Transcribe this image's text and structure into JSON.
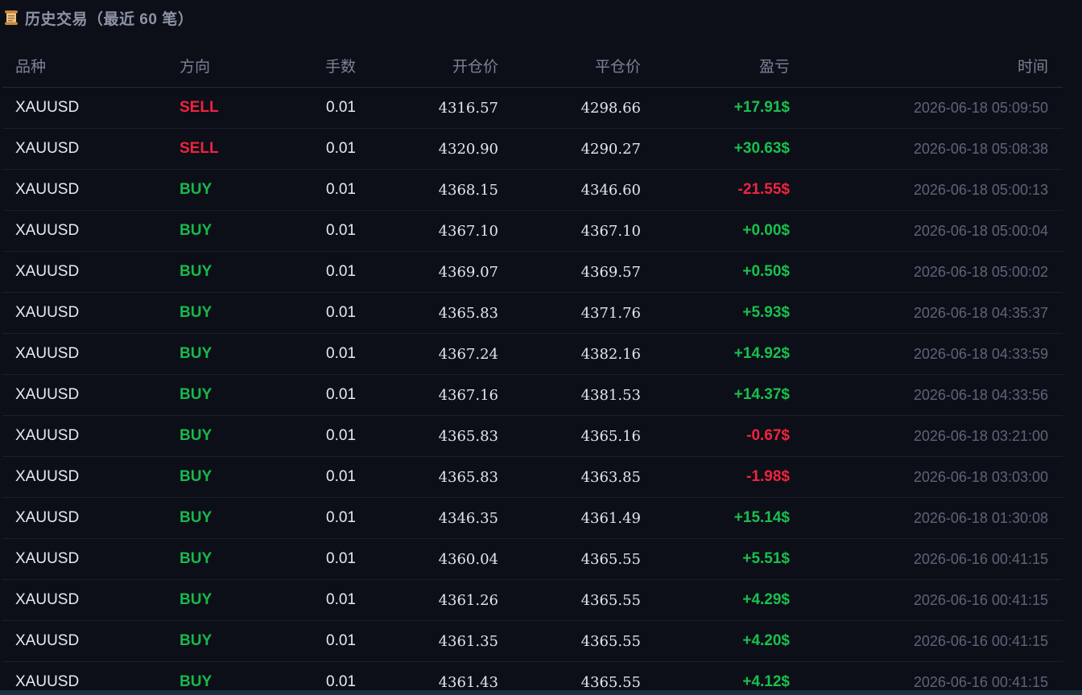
{
  "panel": {
    "icon": "scroll-icon",
    "title": "历史交易（最近 60 笔）"
  },
  "columns": {
    "symbol": "品种",
    "direction": "方向",
    "lots": "手数",
    "open_price": "开仓价",
    "close_price": "平仓价",
    "pnl": "盈亏",
    "time": "时间"
  },
  "colors": {
    "background": "#0c0f18",
    "sell": "#f0233f",
    "buy": "#19b84b",
    "profit": "#19c04e",
    "loss": "#f0233f"
  },
  "trades": [
    {
      "symbol": "XAUUSD",
      "direction": "SELL",
      "lots": "0.01",
      "open": "4316.57",
      "close": "4298.66",
      "pnl": "+17.91$",
      "time": "2026-06-18 05:09:50"
    },
    {
      "symbol": "XAUUSD",
      "direction": "SELL",
      "lots": "0.01",
      "open": "4320.90",
      "close": "4290.27",
      "pnl": "+30.63$",
      "time": "2026-06-18 05:08:38"
    },
    {
      "symbol": "XAUUSD",
      "direction": "BUY",
      "lots": "0.01",
      "open": "4368.15",
      "close": "4346.60",
      "pnl": "-21.55$",
      "time": "2026-06-18 05:00:13"
    },
    {
      "symbol": "XAUUSD",
      "direction": "BUY",
      "lots": "0.01",
      "open": "4367.10",
      "close": "4367.10",
      "pnl": "+0.00$",
      "time": "2026-06-18 05:00:04"
    },
    {
      "symbol": "XAUUSD",
      "direction": "BUY",
      "lots": "0.01",
      "open": "4369.07",
      "close": "4369.57",
      "pnl": "+0.50$",
      "time": "2026-06-18 05:00:02"
    },
    {
      "symbol": "XAUUSD",
      "direction": "BUY",
      "lots": "0.01",
      "open": "4365.83",
      "close": "4371.76",
      "pnl": "+5.93$",
      "time": "2026-06-18 04:35:37"
    },
    {
      "symbol": "XAUUSD",
      "direction": "BUY",
      "lots": "0.01",
      "open": "4367.24",
      "close": "4382.16",
      "pnl": "+14.92$",
      "time": "2026-06-18 04:33:59"
    },
    {
      "symbol": "XAUUSD",
      "direction": "BUY",
      "lots": "0.01",
      "open": "4367.16",
      "close": "4381.53",
      "pnl": "+14.37$",
      "time": "2026-06-18 04:33:56"
    },
    {
      "symbol": "XAUUSD",
      "direction": "BUY",
      "lots": "0.01",
      "open": "4365.83",
      "close": "4365.16",
      "pnl": "-0.67$",
      "time": "2026-06-18 03:21:00"
    },
    {
      "symbol": "XAUUSD",
      "direction": "BUY",
      "lots": "0.01",
      "open": "4365.83",
      "close": "4363.85",
      "pnl": "-1.98$",
      "time": "2026-06-18 03:03:00"
    },
    {
      "symbol": "XAUUSD",
      "direction": "BUY",
      "lots": "0.01",
      "open": "4346.35",
      "close": "4361.49",
      "pnl": "+15.14$",
      "time": "2026-06-18 01:30:08"
    },
    {
      "symbol": "XAUUSD",
      "direction": "BUY",
      "lots": "0.01",
      "open": "4360.04",
      "close": "4365.55",
      "pnl": "+5.51$",
      "time": "2026-06-16 00:41:15"
    },
    {
      "symbol": "XAUUSD",
      "direction": "BUY",
      "lots": "0.01",
      "open": "4361.26",
      "close": "4365.55",
      "pnl": "+4.29$",
      "time": "2026-06-16 00:41:15"
    },
    {
      "symbol": "XAUUSD",
      "direction": "BUY",
      "lots": "0.01",
      "open": "4361.35",
      "close": "4365.55",
      "pnl": "+4.20$",
      "time": "2026-06-16 00:41:15"
    },
    {
      "symbol": "XAUUSD",
      "direction": "BUY",
      "lots": "0.01",
      "open": "4361.43",
      "close": "4365.55",
      "pnl": "+4.12$",
      "time": "2026-06-16 00:41:15"
    }
  ]
}
